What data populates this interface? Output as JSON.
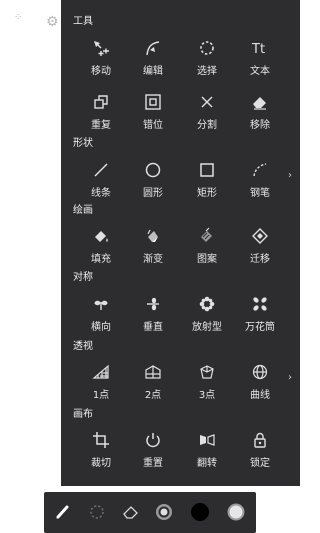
{
  "sections": [
    {
      "title": "工具",
      "tools": [
        {
          "label": "移动",
          "icon": "move-icon"
        },
        {
          "label": "编辑",
          "icon": "edit-icon"
        },
        {
          "label": "选择",
          "icon": "select-icon"
        },
        {
          "label": "文本",
          "icon": "text-icon"
        },
        {
          "label": "重复",
          "icon": "duplicate-icon"
        },
        {
          "label": "错位",
          "icon": "offset-icon"
        },
        {
          "label": "分割",
          "icon": "split-icon"
        },
        {
          "label": "移除",
          "icon": "eraser-icon"
        }
      ]
    },
    {
      "title": "形状",
      "tools": [
        {
          "label": "线条",
          "icon": "line-icon"
        },
        {
          "label": "圆形",
          "icon": "circle-icon"
        },
        {
          "label": "矩形",
          "icon": "rectangle-icon"
        },
        {
          "label": "钢笔",
          "icon": "pen-curve-icon"
        }
      ]
    },
    {
      "title": "绘画",
      "tools": [
        {
          "label": "填充",
          "icon": "fill-icon"
        },
        {
          "label": "渐变",
          "icon": "gradient-icon"
        },
        {
          "label": "图案",
          "icon": "pattern-icon"
        },
        {
          "label": "迁移",
          "icon": "transfer-icon"
        }
      ]
    },
    {
      "title": "对称",
      "tools": [
        {
          "label": "横向",
          "icon": "horizontal-symmetry-icon"
        },
        {
          "label": "垂直",
          "icon": "vertical-symmetry-icon"
        },
        {
          "label": "放射型",
          "icon": "radial-symmetry-icon"
        },
        {
          "label": "万花筒",
          "icon": "kaleidoscope-icon"
        }
      ]
    },
    {
      "title": "透视",
      "tools": [
        {
          "label": "1点",
          "icon": "one-point-perspective-icon"
        },
        {
          "label": "2点",
          "icon": "two-point-perspective-icon"
        },
        {
          "label": "3点",
          "icon": "three-point-perspective-icon"
        },
        {
          "label": "曲线",
          "icon": "curve-perspective-icon"
        }
      ]
    },
    {
      "title": "画布",
      "tools": [
        {
          "label": "裁切",
          "icon": "crop-icon"
        },
        {
          "label": "重置",
          "icon": "reset-icon"
        },
        {
          "label": "翻转",
          "icon": "flip-icon"
        },
        {
          "label": "锁定",
          "icon": "lock-icon"
        }
      ]
    }
  ],
  "bottom_bar": [
    {
      "icon": "brush-icon"
    },
    {
      "icon": "lasso-select-icon"
    },
    {
      "icon": "eraser-icon"
    },
    {
      "icon": "brush-size-icon"
    },
    {
      "icon": "color-swatch-icon",
      "color": "#000000"
    },
    {
      "icon": "opacity-icon"
    }
  ],
  "colors": {
    "panel_bg": "#2d2d2f",
    "text": "#e8e8e8"
  }
}
